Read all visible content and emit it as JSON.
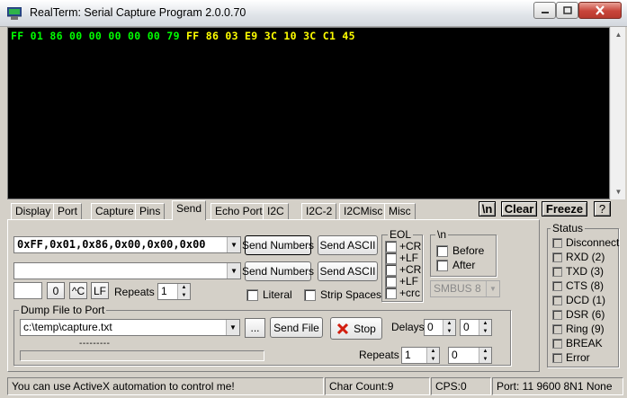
{
  "window": {
    "title": "RealTerm: Serial Capture Program 2.0.0.70"
  },
  "terminal": {
    "segments": [
      {
        "text": "FF 01 86 00 00 00 00 00 79 ",
        "color": "#00ff00"
      },
      {
        "text": "FF 86 03 E9 3C 10 3C C1 45",
        "color": "#ffff00"
      }
    ],
    "background": "#000000"
  },
  "tabs": [
    "Display",
    "Port",
    "Capture",
    "Pins",
    "Send",
    "Echo Port",
    "I2C",
    "I2C-2",
    "I2CMisc",
    "Misc"
  ],
  "active_tab": "Send",
  "right_buttons": {
    "newline": "\\n",
    "clear": "Clear",
    "freeze": "Freeze",
    "help": "?"
  },
  "send": {
    "row1_value": "0xFF,0x01,0x86,0x00,0x00,0x00",
    "row2_value": "",
    "send_numbers": "Send Numbers",
    "send_ascii": "Send ASCII",
    "small_input": "",
    "zero_btn": "0",
    "ctrl_c_btn": "^C",
    "lf_btn": "LF",
    "repeats_label": "Repeats",
    "repeats_value": "1",
    "literal_label": "Literal",
    "strip_spaces_label": "Strip Spaces"
  },
  "eol": {
    "title": "EOL",
    "items": [
      "+CR",
      "+LF",
      "+CR",
      "+LF",
      "+crc"
    ]
  },
  "newline_group": {
    "title": "\\n",
    "before": "Before",
    "after": "After"
  },
  "smbus": {
    "value": "SMBUS 8"
  },
  "dump": {
    "title": "Dump File to Port",
    "file_path": "c:\\temp\\capture.txt",
    "browse_label": "...",
    "send_file": "Send File",
    "stop": "Stop",
    "delays_label": "Delays",
    "delay1": "0",
    "delay2": "0",
    "repeats_label": "Repeats",
    "repeats1": "1",
    "repeats2": "0",
    "progress_text": "---------"
  },
  "status_panel": {
    "title": "Status",
    "items": [
      "Disconnect",
      "RXD (2)",
      "TXD (3)",
      "CTS (8)",
      "DCD (1)",
      "DSR (6)",
      "Ring (9)",
      "BREAK",
      "Error"
    ]
  },
  "statusbar": {
    "message": "You can use ActiveX automation to control me!",
    "char_count": "Char Count:9",
    "cps": "CPS:0",
    "port": "Port: 11 9600 8N1 None"
  }
}
